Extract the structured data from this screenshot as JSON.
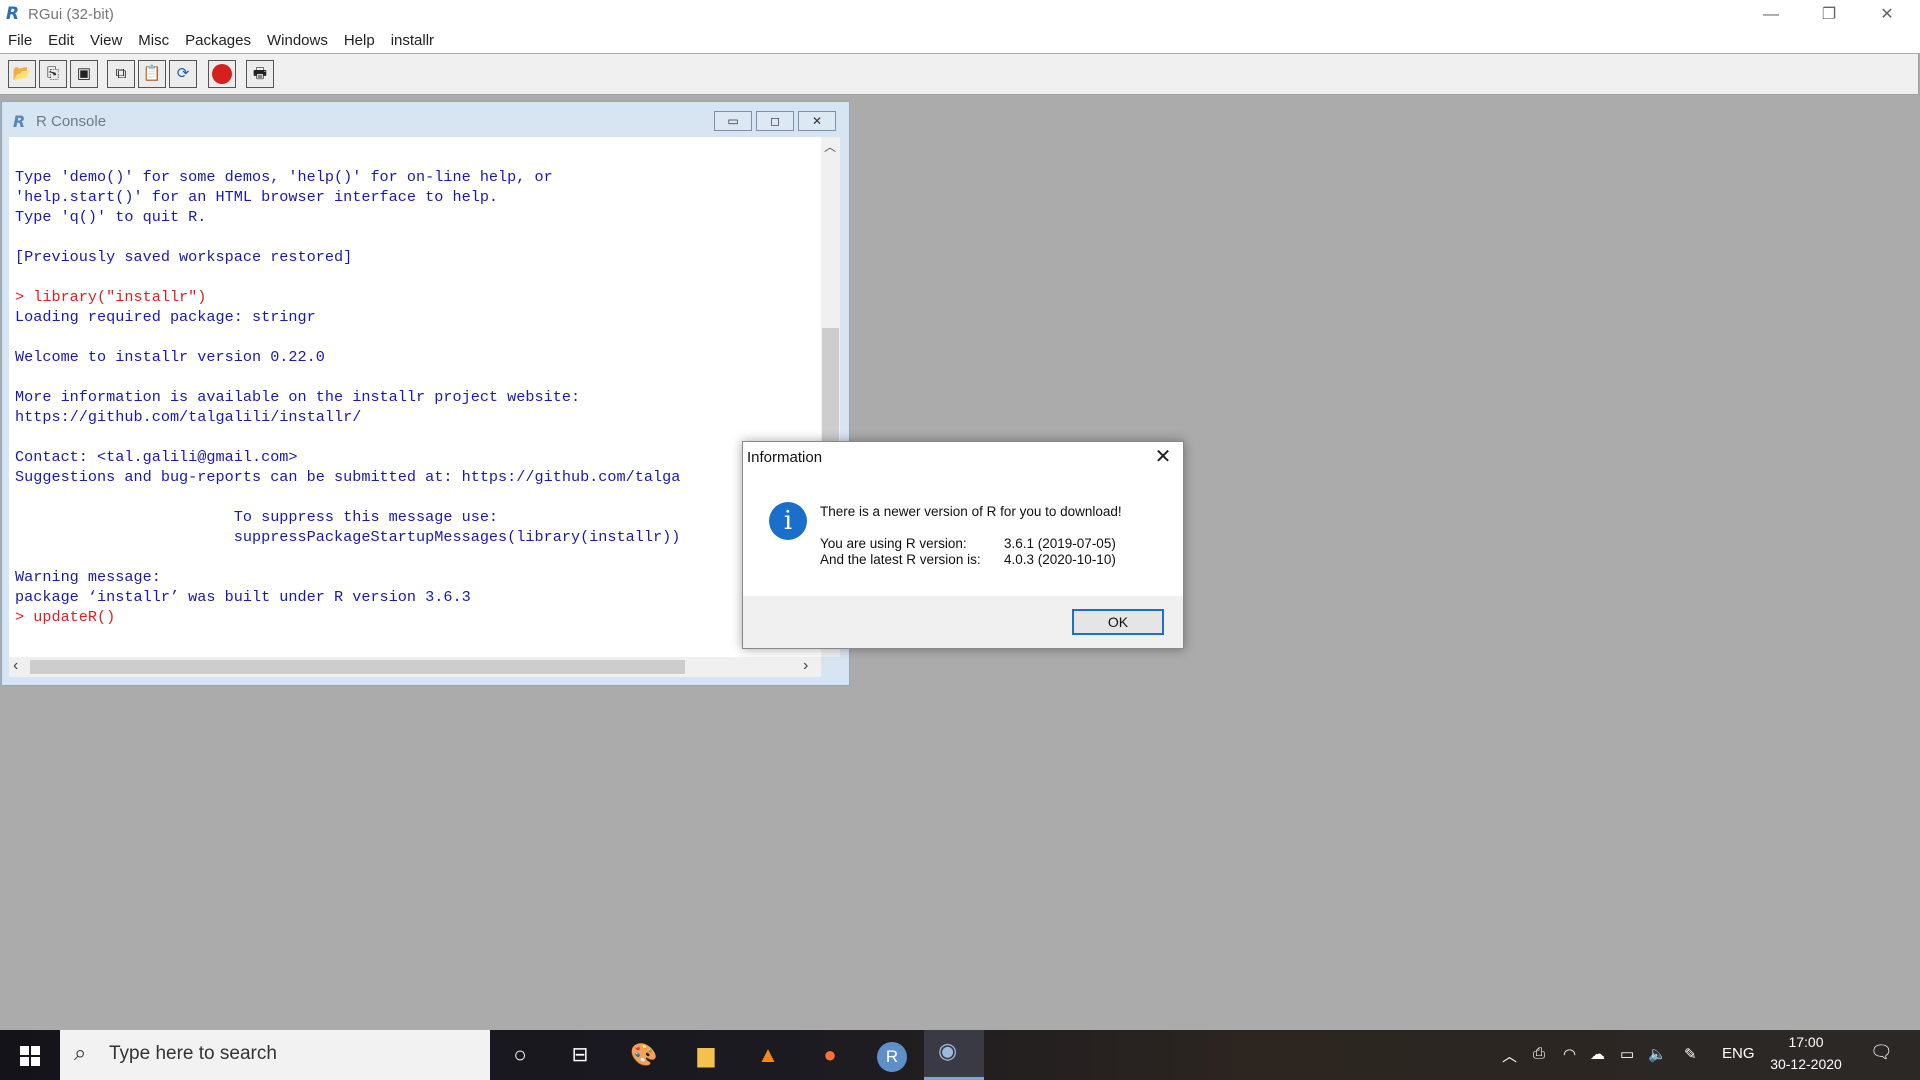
{
  "window": {
    "title": "RGui (32-bit)",
    "minimize_glyph": "—",
    "restore_glyph": "❐",
    "close_glyph": "✕"
  },
  "menu": [
    "File",
    "Edit",
    "View",
    "Misc",
    "Packages",
    "Windows",
    "Help",
    "installr"
  ],
  "toolbar": {
    "buttons": [
      "open-script",
      "load-workspace",
      "save-workspace",
      "copy",
      "paste",
      "copy-paste",
      "stop",
      "print"
    ]
  },
  "console": {
    "title": "R Console",
    "lines": [
      {
        "text": "Type 'demo()' for some demos, 'help()' for on-line help, or",
        "color": "blue"
      },
      {
        "text": "'help.start()' for an HTML browser interface to help.",
        "color": "blue"
      },
      {
        "text": "Type 'q()' to quit R.",
        "color": "blue"
      },
      {
        "text": "",
        "color": "blue"
      },
      {
        "text": "[Previously saved workspace restored]",
        "color": "blue"
      },
      {
        "text": "",
        "color": "blue"
      },
      {
        "text": "> library(\"installr\")",
        "color": "red"
      },
      {
        "text": "Loading required package: stringr",
        "color": "blue"
      },
      {
        "text": "",
        "color": "blue"
      },
      {
        "text": "Welcome to installr version 0.22.0",
        "color": "blue"
      },
      {
        "text": "",
        "color": "blue"
      },
      {
        "text": "More information is available on the installr project website:",
        "color": "blue"
      },
      {
        "text": "https://github.com/talgalili/installr/",
        "color": "blue"
      },
      {
        "text": "",
        "color": "blue"
      },
      {
        "text": "Contact: <tal.galili@gmail.com>",
        "color": "blue"
      },
      {
        "text": "Suggestions and bug-reports can be submitted at: https://github.com/talga",
        "color": "blue"
      },
      {
        "text": "",
        "color": "blue"
      },
      {
        "text": "                        To suppress this message use:",
        "color": "blue"
      },
      {
        "text": "                        suppressPackageStartupMessages(library(installr))",
        "color": "blue"
      },
      {
        "text": "",
        "color": "blue"
      },
      {
        "text": "Warning message:",
        "color": "blue"
      },
      {
        "text": "package ‘installr’ was built under R version 3.6.3",
        "color": "blue"
      },
      {
        "text": "> updateR()",
        "color": "red"
      }
    ]
  },
  "dialog": {
    "title": "Information",
    "headline": "There is a newer version of R for you to download!",
    "using_label": "You are using R version:",
    "using_value": "3.6.1 (2019-07-05)",
    "latest_label": "And the latest R version is:",
    "latest_value": "4.0.3 (2020-10-10)",
    "ok_label": "OK"
  },
  "taskbar": {
    "search_placeholder": "Type here to search",
    "tray_language": "ENG",
    "time": "17:00",
    "date": "30-12-2020"
  },
  "colors": {
    "console_text": "#1a1ab0",
    "console_input": "#e02020",
    "accent": "#1e6fc7"
  }
}
